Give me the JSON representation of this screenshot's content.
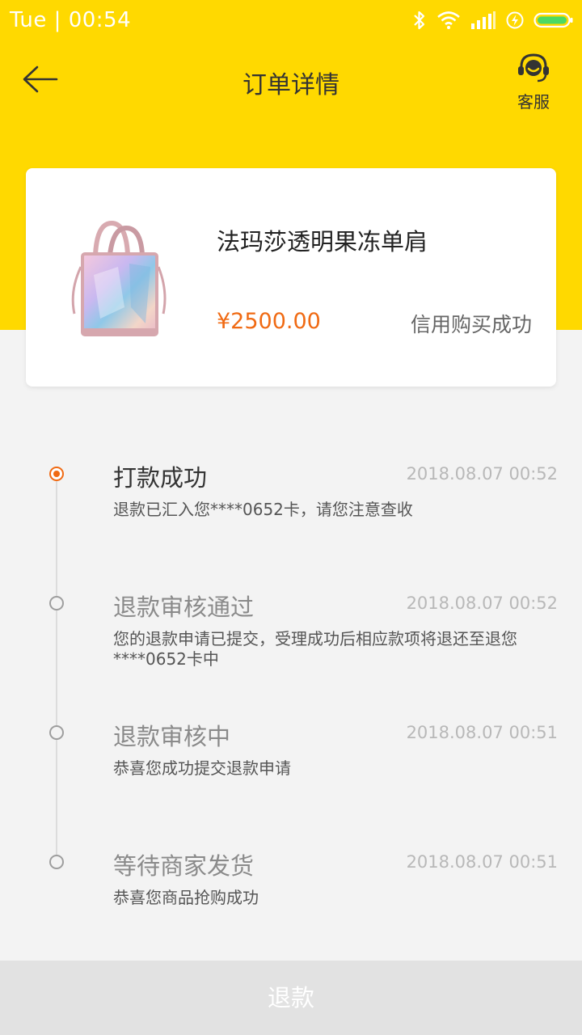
{
  "status_bar": {
    "time": "Tue | 00:54"
  },
  "header": {
    "title": "订单详情",
    "service_label": "客服"
  },
  "product": {
    "name": "法玛莎透明果冻单肩",
    "price": "¥2500.00",
    "status": "信用购买成功"
  },
  "timeline": [
    {
      "title": "打款成功",
      "time": "2018.08.07 00:52",
      "desc": "退款已汇入您****0652卡，请您注意查收",
      "active": true
    },
    {
      "title": "退款审核通过",
      "time": "2018.08.07 00:52",
      "desc": "您的退款申请已提交，受理成功后相应款项将退还至退您****0652卡中",
      "active": false
    },
    {
      "title": "退款审核中",
      "time": "2018.08.07 00:51",
      "desc": "恭喜您成功提交退款申请",
      "active": false
    },
    {
      "title": "等待商家发货",
      "time": "2018.08.07 00:51",
      "desc": "恭喜您商品抢购成功",
      "active": false
    }
  ],
  "footer": {
    "refund_label": "退款"
  },
  "colors": {
    "brand_yellow": "#ffd900",
    "accent_orange": "#f06a13"
  }
}
